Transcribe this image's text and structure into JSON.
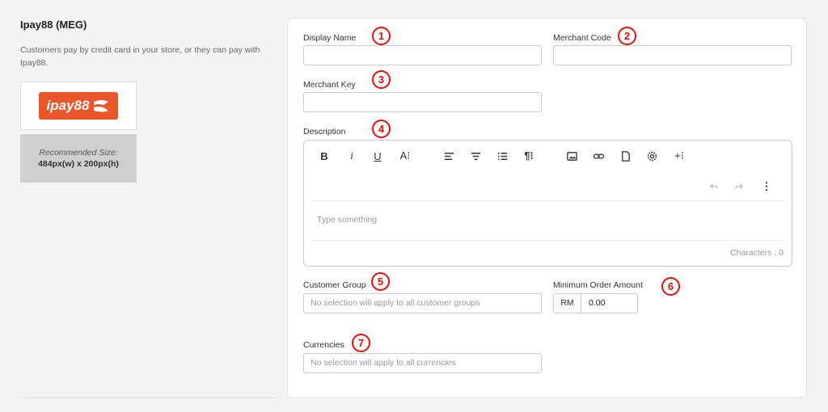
{
  "sidebar": {
    "title": "Ipay88 (MEG)",
    "description": "Customers pay by credit card in your store, or they can pay with Ipay88.",
    "logo_text": "ipay88",
    "recommended_label": "Recommended Size:",
    "recommended_size": "484px(w) x 200px(h)"
  },
  "form": {
    "display_name": {
      "label": "Display Name",
      "value": "",
      "marker": "1"
    },
    "merchant_code": {
      "label": "Merchant Code",
      "value": "",
      "marker": "2"
    },
    "merchant_key": {
      "label": "Merchant Key",
      "value": "",
      "marker": "3"
    },
    "description": {
      "label": "Description",
      "marker": "4",
      "placeholder": "Type something",
      "characters": "Characters : 0",
      "toolbar": [
        "bold",
        "italic",
        "underline",
        "font-size",
        "align-left",
        "align-center",
        "list",
        "paragraph",
        "image",
        "link",
        "file",
        "settings",
        "more",
        "undo",
        "redo",
        "more-vertical"
      ]
    },
    "customer_group": {
      "label": "Customer Group",
      "placeholder": "No selection will apply to all customer groups",
      "marker": "5"
    },
    "min_order": {
      "label": "Minimum Order Amount",
      "currency": "RM",
      "value": "0.00",
      "marker": "6"
    },
    "currencies": {
      "label": "Currencies",
      "placeholder": "No selection will apply to all currencies",
      "marker": "7"
    }
  },
  "colors": {
    "marker": "#e01010",
    "brand": "#e8562a"
  }
}
